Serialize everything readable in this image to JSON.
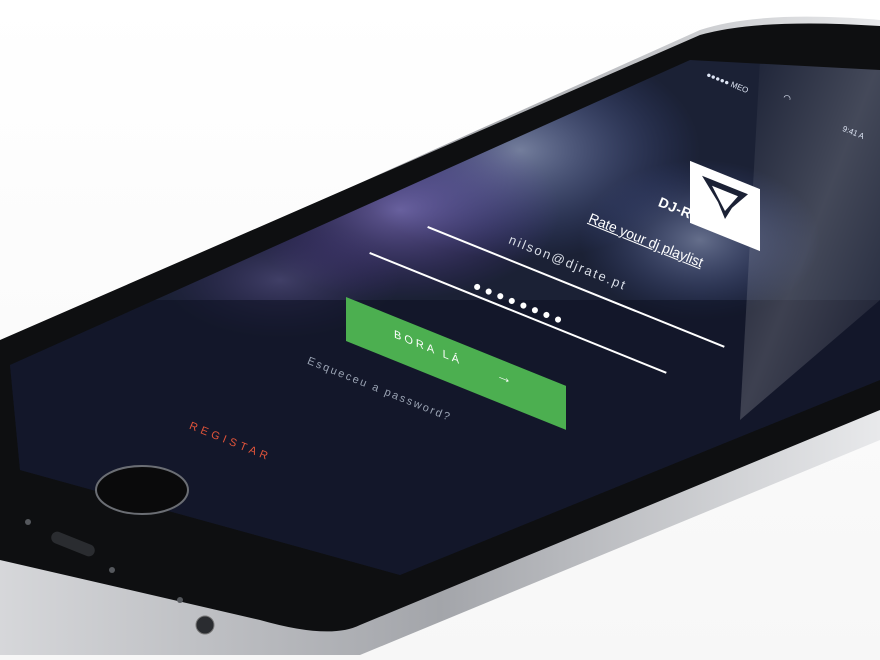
{
  "status_bar": {
    "carrier": "●●●●● MEO",
    "wifi_icon": "wifi-icon",
    "time": "9:41 A"
  },
  "app": {
    "name": "DJ-RATE",
    "tagline": "Rate your dj playlist"
  },
  "login_form": {
    "email_value": "nilson@djrate.pt",
    "password_value": "●●●●●●●●",
    "submit_label": "BORA LÁ",
    "submit_icon": "arrow-right-icon",
    "forgot_password": "Esqueceu a password?"
  },
  "footer": {
    "register_label": "REGISTAR"
  },
  "colors": {
    "accent": "#4caf50",
    "register": "#e1543a",
    "screen_bg": "#1c2236",
    "phone_body": "#2b2d31"
  }
}
